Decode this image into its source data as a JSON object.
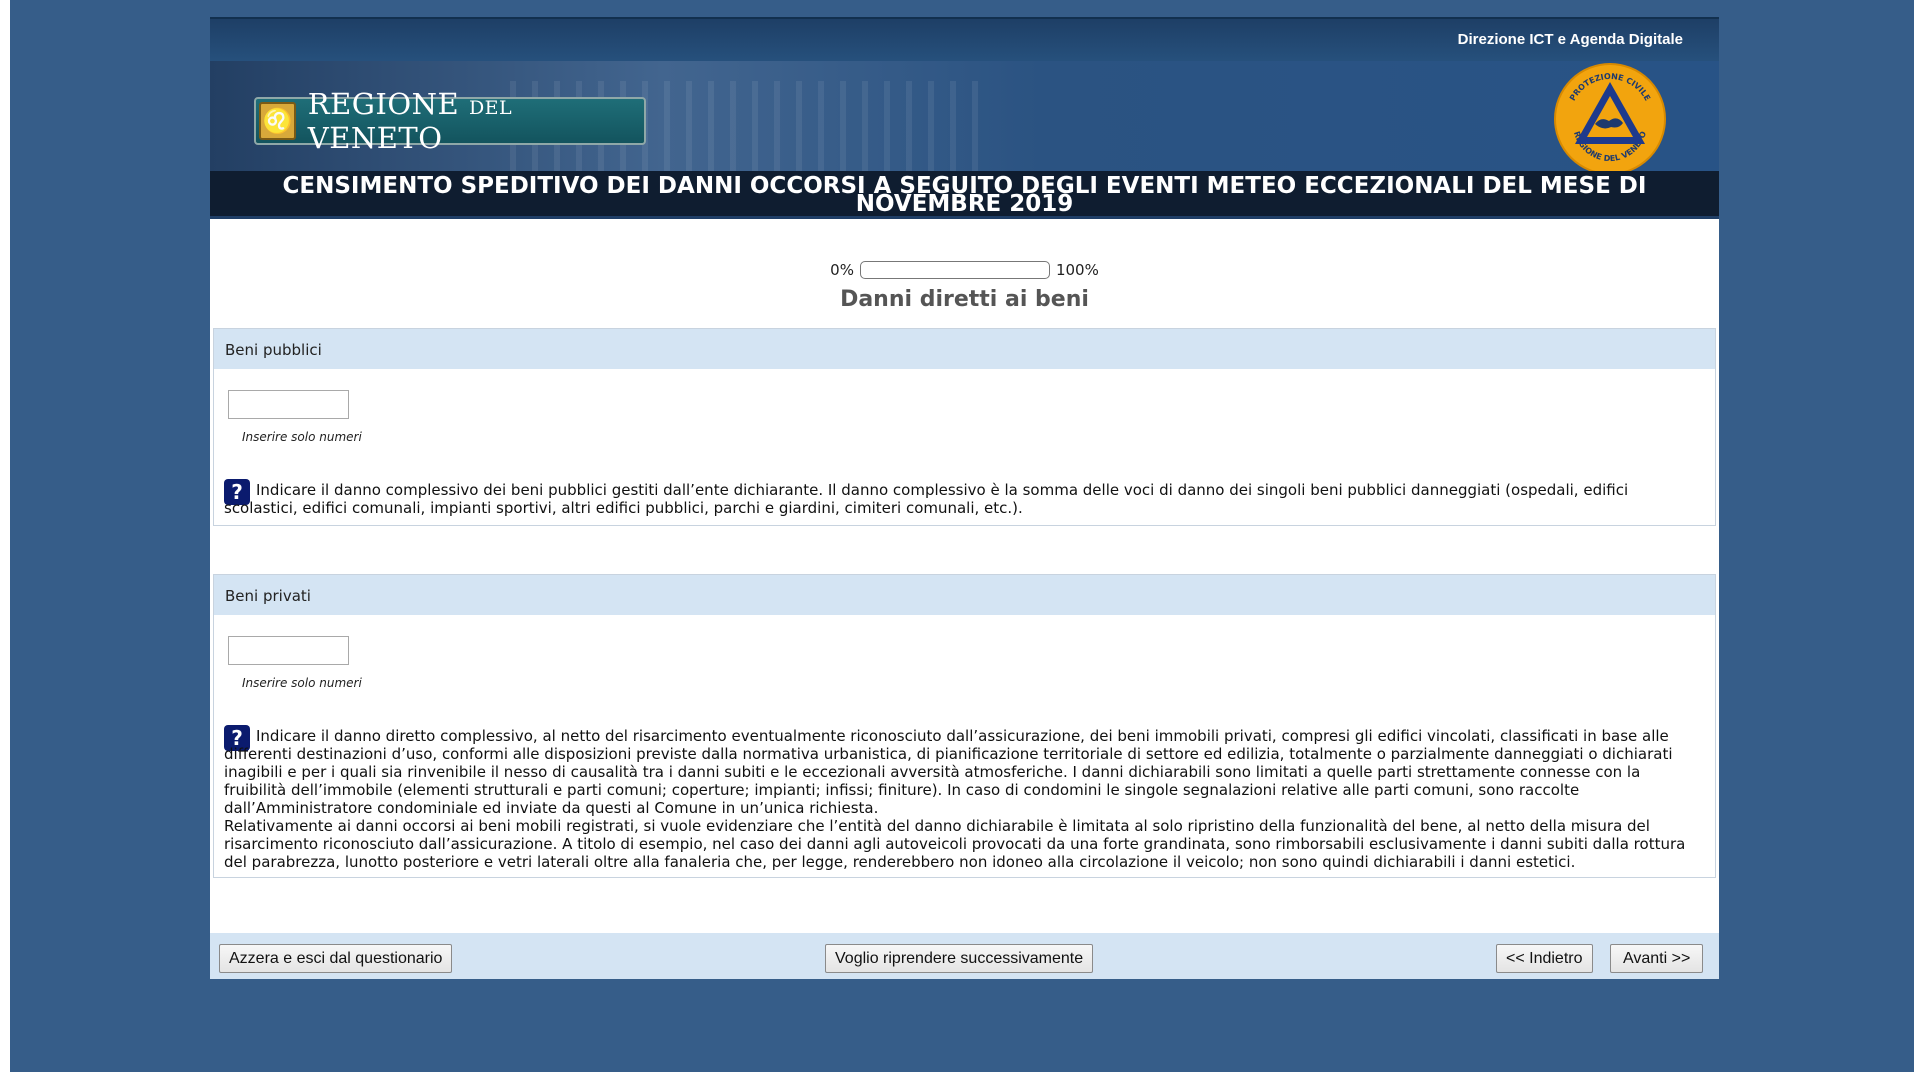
{
  "header": {
    "org_label": "Direzione ICT e Agenda Digitale",
    "logo_text_main": "REGIONE",
    "logo_text_small": "DEL",
    "logo_text_end": "VENETO",
    "badge_top_text": "PROTEZIONE CIVILE",
    "badge_bottom_text": "REGIONE DEL VENETO",
    "title": "CENSIMENTO SPEDITIVO DEI DANNI OCCORSI A SEGUITO DEGLI EVENTI METEO ECCEZIONALI DEL MESE DI NOVEMBRE 2019"
  },
  "progress": {
    "start_label": "0%",
    "end_label": "100%",
    "value": 0
  },
  "section_title": "Danni diretti ai beni",
  "panels": [
    {
      "heading": "Beni pubblici",
      "input_value": "",
      "hint": "Inserire solo numeri",
      "description": "Indicare il danno complessivo dei beni pubblici gestiti dall’ente dichiarante. Il danno complessivo è la somma delle voci di danno dei singoli beni pubblici danneggiati (ospedali, edifici scolastici, edifici comunali, impianti sportivi, altri edifici pubblici, parchi e giardini, cimiteri comunali, etc.)."
    },
    {
      "heading": "Beni privati",
      "input_value": "",
      "hint": "Inserire solo numeri",
      "description": "Indicare il danno diretto complessivo, al netto del risarcimento eventualmente riconosciuto dall’assicurazione, dei beni immobili privati, compresi gli edifici vincolati, classificati in base alle differenti destinazioni d’uso, conformi alle disposizioni previste dalla normativa urbanistica, di pianificazione territoriale di settore ed edilizia, totalmente o parzialmente danneggiati o dichiarati inagibili e per i quali sia rinvenibile il nesso di causalità tra i danni subiti e le eccezionali avversità atmosferiche. I danni dichiarabili sono limitati a quelle parti strettamente connesse con la fruibilità dell’immobile (elementi strutturali e parti comuni; coperture; impianti; infissi; finiture). In caso di condomini le singole segnalazioni relative alle parti comuni, sono raccolte dall’Amministratore condominiale ed inviate da questi al Comune in un’unica richiesta.",
      "description_2": "Relativamente ai danni occorsi ai beni mobili registrati, si vuole evidenziare che l’entità del danno dichiarabile è limitata al solo ripristino della funzionalità del bene, al netto della misura del risarcimento riconosciuto dall’assicurazione. A titolo di esempio, nel caso dei danni agli autoveicoli provocati da una forte grandinata, sono rimborsabili esclusivamente i danni subiti dalla rottura del parabrezza, lunotto posteriore e vetri laterali oltre alla fanaleria che, per legge, renderebbero non idoneo alla circolazione il veicolo; non sono quindi dichiarabili i danni estetici."
    }
  ],
  "help_icon_glyph": "?",
  "footer": {
    "reset_label": "Azzera e esci dal questionario",
    "resume_label": "Voglio riprendere successivamente",
    "back_label": "<< Indietro",
    "next_label": "Avanti >>"
  },
  "colors": {
    "background": "#365d89",
    "panel_header": "#d4e4f3",
    "title_bar": "#0f1d30",
    "help_icon": "#0b1b6e"
  }
}
